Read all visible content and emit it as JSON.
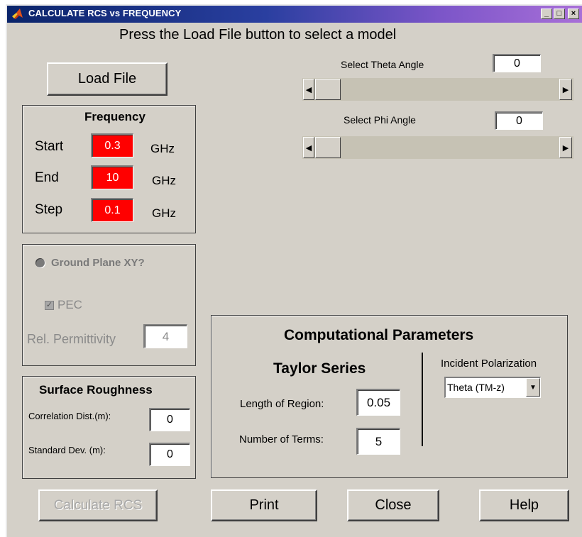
{
  "window": {
    "title": "CALCULATE RCS vs FREQUENCY",
    "minimize": "_",
    "maximize": "□",
    "close": "×"
  },
  "header": {
    "instruction": "Press the Load File button to select a model"
  },
  "load_button": "Load File",
  "theta": {
    "label": "Select Theta Angle",
    "value": "0"
  },
  "phi": {
    "label": "Select Phi Angle",
    "value": "0"
  },
  "slider": {
    "left_arrow": "◀",
    "right_arrow": "▶"
  },
  "frequency": {
    "title": "Frequency",
    "start_label": "Start",
    "start_value": "0.3",
    "start_unit": "GHz",
    "end_label": "End",
    "end_value": "10",
    "end_unit": "GHz",
    "step_label": "Step",
    "step_value": "0.1",
    "step_unit": "GHz"
  },
  "ground_plane": {
    "radio_label": "Ground Plane XY?",
    "pec_label": "PEC",
    "permittivity_label": "Rel. Permittivity",
    "permittivity_value": "4"
  },
  "roughness": {
    "title": "Surface Roughness",
    "corr_label": "Correlation Dist.(m):",
    "corr_value": "0",
    "std_label": "Standard Dev. (m):",
    "std_value": "0"
  },
  "computational": {
    "title": "Computational Parameters",
    "taylor_title": "Taylor Series",
    "length_label": "Length of Region:",
    "length_value": "0.05",
    "terms_label": "Number of Terms:",
    "terms_value": "5",
    "polarization_label": "Incident Polarization",
    "polarization_value": "Theta (TM-z)"
  },
  "buttons": {
    "calculate": "Calculate RCS",
    "print": "Print",
    "close": "Close",
    "help": "Help"
  },
  "colors": {
    "accent_red": "#ff0000",
    "face": "#d4d0c8"
  }
}
